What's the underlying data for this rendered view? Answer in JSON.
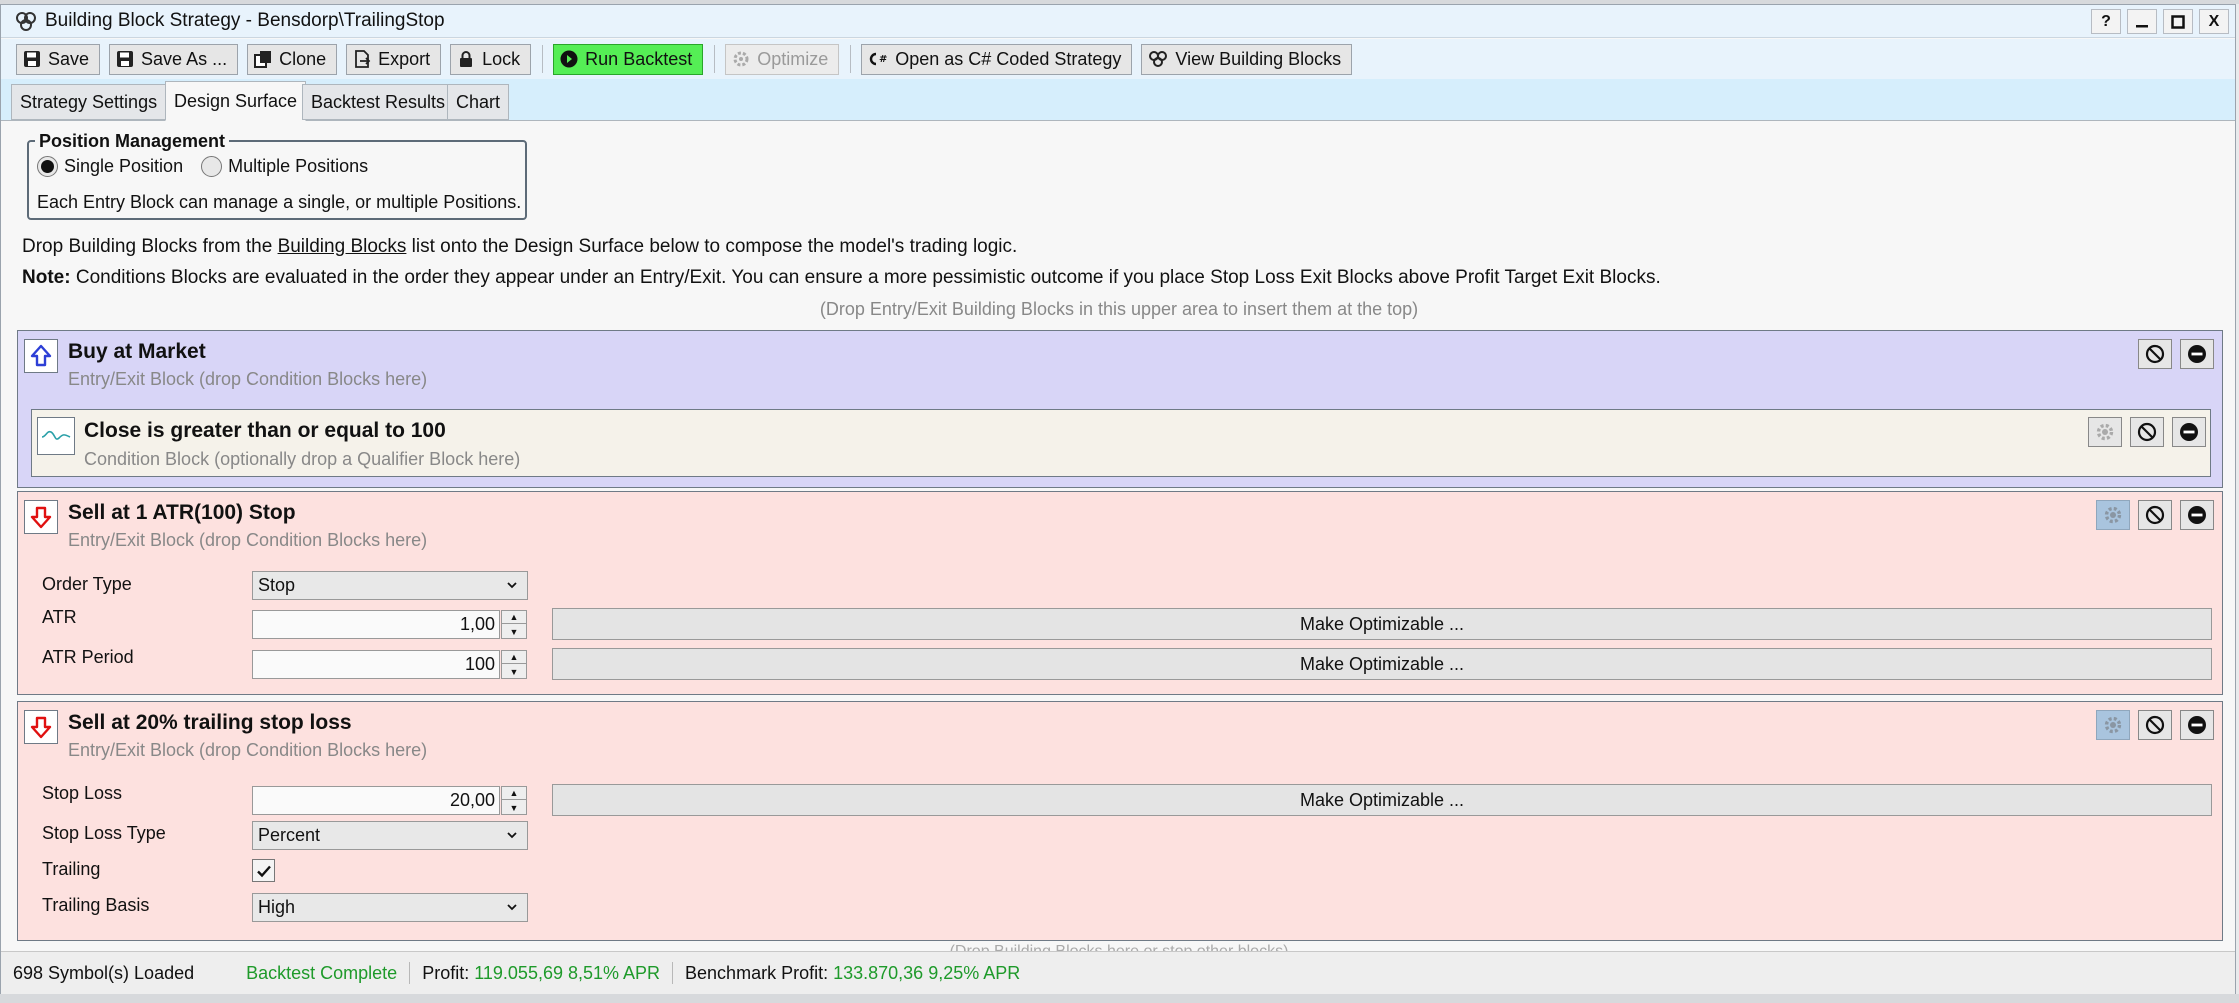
{
  "window": {
    "title": "Building Block Strategy - Bensdorp\\TrailingStop"
  },
  "window_buttons": {
    "help": "?",
    "minimize": "—",
    "maximize": "◻",
    "close": "X"
  },
  "toolbar": {
    "save": "Save",
    "save_as": "Save As ...",
    "clone": "Clone",
    "export": "Export",
    "lock": "Lock",
    "run_backtest": "Run Backtest",
    "optimize": "Optimize",
    "open_csharp": "Open as C# Coded Strategy",
    "view_blocks": "View Building Blocks"
  },
  "tabs": [
    {
      "label": "Strategy Settings"
    },
    {
      "label": "Design Surface"
    },
    {
      "label": "Backtest Results"
    },
    {
      "label": "Chart"
    }
  ],
  "position_management": {
    "legend": "Position Management",
    "single": "Single Position",
    "multiple": "Multiple Positions",
    "selected": "single",
    "note": "Each Entry Block can manage a single, or multiple Positions."
  },
  "info": {
    "line1_pre": "Drop Building Blocks from the ",
    "line1_link": "Building Blocks",
    "line1_post": " list onto the Design Surface below to compose the model's trading logic.",
    "note_label": "Note:",
    "note_text": " Conditions Blocks are evaluated in the order they appear under an Entry/Exit. You can ensure a more pessimistic outcome if you place Stop Loss Exit Blocks above Profit Target Exit Blocks.",
    "drop_top": "(Drop Entry/Exit Building Blocks in this upper area to insert them at the top)",
    "drop_bottom": "(Drop Building Blocks here or stop other blocks)"
  },
  "blocks": {
    "buy": {
      "title": "Buy at Market",
      "subtitle": "Entry/Exit Block (drop Condition Blocks here)",
      "condition": {
        "title": "Close is greater than or equal to 100",
        "subtitle": "Condition Block (optionally drop a Qualifier Block here)"
      }
    },
    "sell_atr": {
      "title": "Sell at 1 ATR(100) Stop",
      "subtitle": "Entry/Exit Block (drop Condition Blocks here)",
      "order_type_label": "Order Type",
      "order_type_value": "Stop",
      "atr_label": "ATR",
      "atr_value": "1,00",
      "atr_period_label": "ATR Period",
      "atr_period_value": "100",
      "make_optimizable": "Make Optimizable ..."
    },
    "sell_trailing": {
      "title": "Sell at 20% trailing stop loss",
      "subtitle": "Entry/Exit Block (drop Condition Blocks here)",
      "stop_loss_label": "Stop Loss",
      "stop_loss_value": "20,00",
      "stop_loss_type_label": "Stop Loss Type",
      "stop_loss_type_value": "Percent",
      "trailing_label": "Trailing",
      "trailing_checked": true,
      "trailing_basis_label": "Trailing Basis",
      "trailing_basis_value": "High",
      "make_optimizable": "Make Optimizable ..."
    }
  },
  "status": {
    "symbols": "698 Symbol(s) Loaded",
    "backtest": "Backtest Complete",
    "profit_label": "Profit:",
    "profit_value": "119.055,69 8,51% APR",
    "benchmark_label": "Benchmark Profit:",
    "benchmark_value": "133.870,36 9,25% APR"
  },
  "colors": {
    "entry_block": "#d8d5f7",
    "exit_block": "#fde1df",
    "condition_block": "#f5f2ea",
    "run_button": "#55ee55",
    "profit_text": "#1e9a2a"
  }
}
